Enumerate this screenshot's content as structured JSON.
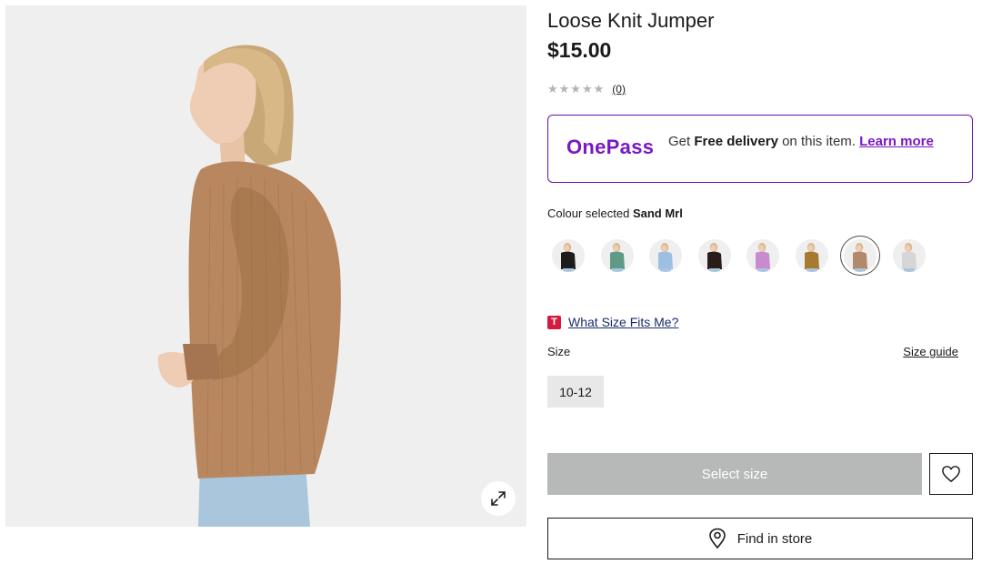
{
  "product": {
    "title": "Loose Knit Jumper",
    "price": "$15.00",
    "rating_stars": "★★★★★",
    "rating_value": 0,
    "review_count": "(0)"
  },
  "onepass": {
    "logo": "OnePass",
    "text_prefix": "Get ",
    "text_bold": "Free delivery",
    "text_suffix": " on this item. ",
    "link": "Learn more",
    "accent_color": "#7a17c4"
  },
  "colour": {
    "label": "Colour selected",
    "selected": "Sand Mrl",
    "swatches": [
      {
        "name": "black",
        "color": "#1c1c1c"
      },
      {
        "name": "green",
        "color": "#5e9a86"
      },
      {
        "name": "blue",
        "color": "#9dbfe2"
      },
      {
        "name": "dark-brown",
        "color": "#2a1c19"
      },
      {
        "name": "pink",
        "color": "#c98bd0"
      },
      {
        "name": "mustard",
        "color": "#a87a30"
      },
      {
        "name": "sand",
        "color": "#b08a6a"
      },
      {
        "name": "grey",
        "color": "#d6d6d6"
      }
    ]
  },
  "size": {
    "help_badge": "T",
    "help_link": "What Size Fits Me?",
    "label": "Size",
    "guide_link": "Size guide",
    "options": [
      "10-12"
    ]
  },
  "actions": {
    "select_size": "Select size",
    "find_in_store": "Find in store"
  },
  "icons": {
    "expand": "expand-icon",
    "wishlist": "heart-icon",
    "store": "location-pin-icon"
  }
}
